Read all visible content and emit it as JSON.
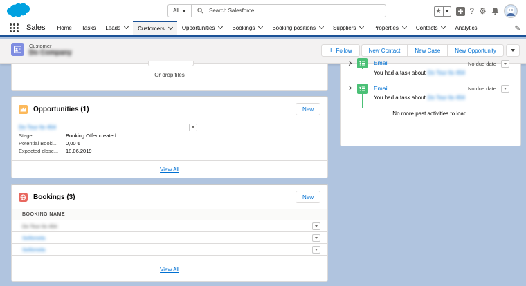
{
  "header": {
    "search_scope": "All",
    "search_placeholder": "Search Salesforce"
  },
  "nav": {
    "app_name": "Sales",
    "items": [
      {
        "label": "Home",
        "has_menu": false
      },
      {
        "label": "Tasks",
        "has_menu": false
      },
      {
        "label": "Leads",
        "has_menu": true
      },
      {
        "label": "Customers",
        "has_menu": true,
        "active": true
      },
      {
        "label": "Opportunities",
        "has_menu": true
      },
      {
        "label": "Bookings",
        "has_menu": true
      },
      {
        "label": "Booking positions",
        "has_menu": true
      },
      {
        "label": "Suppliers",
        "has_menu": true
      },
      {
        "label": "Properties",
        "has_menu": true
      },
      {
        "label": "Contacts",
        "has_menu": true
      },
      {
        "label": "Analytics",
        "has_menu": false
      }
    ]
  },
  "record": {
    "type": "Customer",
    "name": "Do Company",
    "actions": {
      "follow": "Follow",
      "new_contact": "New Contact",
      "new_case": "New Case",
      "new_opportunity": "New Opportunity"
    }
  },
  "files": {
    "drop_text": "Or drop files"
  },
  "opportunities": {
    "title": "Opportunities (1)",
    "new_label": "New",
    "item_name": "Do Tour 6x 454",
    "fields": [
      {
        "label": "Stage:",
        "value": "Booking Offer created"
      },
      {
        "label": "Potential Booki...",
        "value": "0,00 €"
      },
      {
        "label": "Expected close...",
        "value": "18.06.2019"
      }
    ],
    "view_all": "View All"
  },
  "bookings": {
    "title": "Bookings (3)",
    "new_label": "New",
    "column_header": "BOOKING NAME",
    "rows": [
      "Do Tour 6x 454",
      "Seifomela",
      "Seifomela"
    ],
    "view_all": "View All"
  },
  "activity": {
    "items": [
      {
        "title": "Email",
        "due": "No due date",
        "desc": "You had a task about",
        "desc_link": "Do Tour 6x 454"
      },
      {
        "title": "Email",
        "due": "No due date",
        "desc": "You had a task about",
        "desc_link": "Do Tour 6x 454"
      }
    ],
    "no_more": "No more past activities to load."
  },
  "colors": {
    "brand": "#1b5297",
    "link": "#0070d2",
    "background": "#b0c4df",
    "activity_green": "#4bc076",
    "opportunity_icon": "#fcb95b",
    "booking_icon": "#e8675f",
    "record_icon": "#7f8de1"
  }
}
